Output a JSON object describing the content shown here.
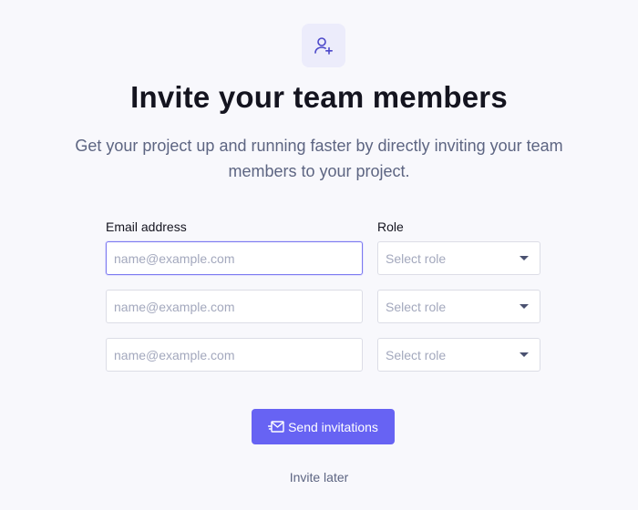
{
  "header": {
    "icon": "user-plus-icon",
    "title": "Invite your team members",
    "subtitle": "Get your project up and running faster by directly inviting your team members to your project."
  },
  "form": {
    "email_label": "Email address",
    "role_label": "Role",
    "rows": [
      {
        "email_placeholder": "name@example.com",
        "email_value": "",
        "role_value": "Select role"
      },
      {
        "email_placeholder": "name@example.com",
        "email_value": "",
        "role_value": "Select role"
      },
      {
        "email_placeholder": "name@example.com",
        "email_value": "",
        "role_value": "Select role"
      }
    ]
  },
  "actions": {
    "send_label": "Send invitations",
    "send_icon": "envelope-send-icon",
    "later_label": "Invite later"
  },
  "colors": {
    "accent": "#6763f3",
    "background": "#f8f8fc",
    "icon_badge": "#ececfb",
    "text": "#14141f",
    "muted": "#5d6582"
  }
}
